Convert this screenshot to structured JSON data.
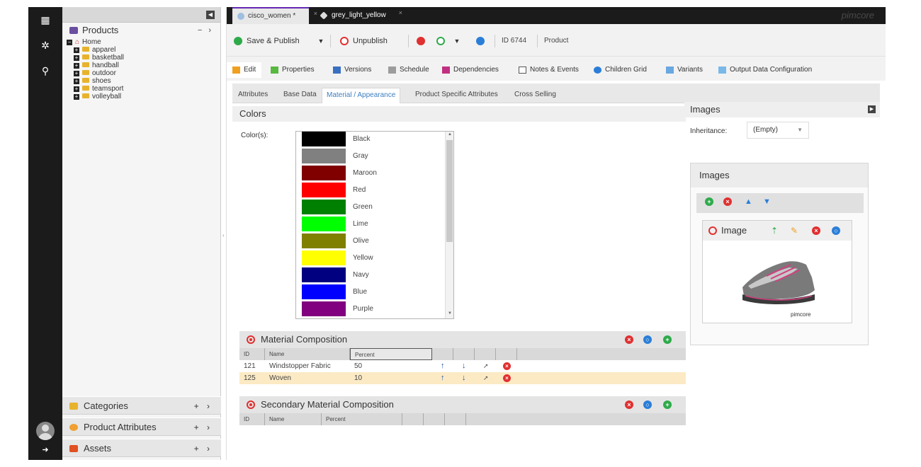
{
  "sidebar_rail": {
    "icons": [
      "grid-icon",
      "gear-icon",
      "search-icon",
      "avatar",
      "logout-icon"
    ]
  },
  "tree": {
    "title": "Products",
    "tools": "− ›",
    "root": "Home",
    "items": [
      "apparel",
      "basketball",
      "handball",
      "outdoor",
      "shoes",
      "teamsport",
      "volleyball"
    ],
    "bottom": [
      {
        "label": "Categories",
        "tools": "+ ›",
        "color": "#e8b32c"
      },
      {
        "label": "Product Attributes",
        "tools": "+ ›",
        "color": "#f0a030"
      },
      {
        "label": "Assets",
        "tools": "+ ›",
        "color": "#e05020"
      }
    ]
  },
  "tabs": [
    {
      "label": "cisco_women *",
      "close": "×",
      "active": true
    },
    {
      "label": "grey_light_yellow",
      "close": "×",
      "active": false
    }
  ],
  "brand": "pimcore",
  "toolbar": {
    "save_publish": "Save & Publish",
    "unpublish": "Unpublish",
    "id_text": "ID 6744",
    "type_text": "Product"
  },
  "main_tabs": [
    "Edit",
    "Properties",
    "Versions",
    "Schedule",
    "Dependencies",
    "Notes & Events",
    "Children Grid",
    "Variants",
    "Output Data Configuration"
  ],
  "sub_tabs": [
    "Attributes",
    "Base Data",
    "Material / Appearance",
    "Product Specific Attributes",
    "Cross Selling"
  ],
  "colors_section": {
    "title": "Colors",
    "label": "Color(s):",
    "options": [
      {
        "name": "Black",
        "hex": "#000000"
      },
      {
        "name": "Gray",
        "hex": "#808080"
      },
      {
        "name": "Maroon",
        "hex": "#800000"
      },
      {
        "name": "Red",
        "hex": "#ff0000"
      },
      {
        "name": "Green",
        "hex": "#008000"
      },
      {
        "name": "Lime",
        "hex": "#00ff00"
      },
      {
        "name": "Olive",
        "hex": "#808000"
      },
      {
        "name": "Yellow",
        "hex": "#ffff00"
      },
      {
        "name": "Navy",
        "hex": "#000080"
      },
      {
        "name": "Blue",
        "hex": "#0000ff"
      },
      {
        "name": "Purple",
        "hex": "#800080"
      }
    ]
  },
  "material_composition": {
    "title": "Material Composition",
    "columns": [
      "ID",
      "Name",
      "Percent"
    ],
    "rows": [
      {
        "id": "121",
        "name": "Windstopper Fabric",
        "percent": "50"
      },
      {
        "id": "125",
        "name": "Woven",
        "percent": "10"
      }
    ]
  },
  "secondary_material_composition": {
    "title": "Secondary Material Composition",
    "columns": [
      "ID",
      "Name",
      "Percent"
    ]
  },
  "images_section": {
    "title": "Images",
    "inheritance_label": "Inheritance:",
    "inheritance_value": "(Empty)",
    "box_title": "Images",
    "card_title": "Image",
    "logo_text": "pimcore"
  }
}
